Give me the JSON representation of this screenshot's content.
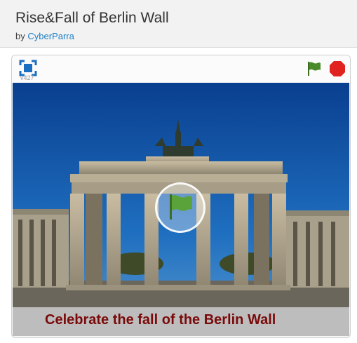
{
  "project": {
    "title": "Rise&Fall of Berlin Wall",
    "by_label": "by",
    "author": "CyberParra"
  },
  "player": {
    "version": "v427",
    "caption": "Celebrate the fall of the Berlin Wall"
  },
  "icons": {
    "fullscreen": "fullscreen-icon",
    "green_flag": "green-flag-icon",
    "stop": "stop-icon",
    "overlay_flag": "green-flag-icon"
  },
  "colors": {
    "flag_green": "#4a8a2a",
    "stop_red": "#e0231e",
    "caption_text": "#7a0a0a",
    "link": "#1b7fc7"
  }
}
